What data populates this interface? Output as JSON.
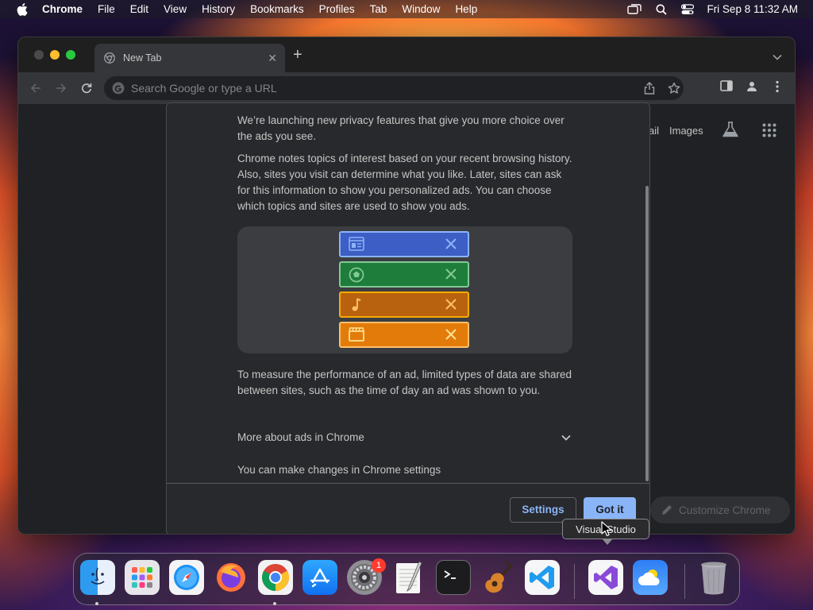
{
  "menubar": {
    "app_name": "Chrome",
    "items": [
      "File",
      "Edit",
      "View",
      "History",
      "Bookmarks",
      "Profiles",
      "Tab",
      "Window",
      "Help"
    ],
    "clock": "Fri Sep 8  11:32 AM"
  },
  "browser": {
    "tab_title": "New Tab",
    "omnibox_placeholder": "Search Google or type a URL",
    "ntp": {
      "gmail_label": "ail",
      "images_label": "Images",
      "customize_label": "Customize Chrome"
    }
  },
  "dialog": {
    "intro": "We’re launching new privacy features that give you more choice over the ads you see.",
    "topics_text": "Chrome notes topics of interest based on your recent browsing history. Also, sites you visit can determine what you like. Later, sites can ask for this information to show you personalized ads. You can choose which topics and sites are used to show you ads.",
    "measure_text": "To measure the performance of an ad, limited types of data are shared between sites, such as the time of day an ad was shown to you.",
    "more_about": "More about ads in Chrome",
    "settings_note": "You can make changes in Chrome settings",
    "settings_button": "Settings",
    "got_it_button": "Got it",
    "chips": [
      {
        "icon": "news-icon",
        "color": "#3d5ec4",
        "border": "#8ab4f8"
      },
      {
        "icon": "soccer-ball-icon",
        "color": "#1e7d3a",
        "border": "#81c995"
      },
      {
        "icon": "music-note-icon",
        "color": "#b8620f",
        "border": "#f9ab00"
      },
      {
        "icon": "clapperboard-icon",
        "color": "#e37b0a",
        "border": "#fdc069"
      }
    ]
  },
  "tooltip": {
    "text": "Visual Studio"
  },
  "dock": {
    "apps": [
      "Finder",
      "Launchpad",
      "Safari",
      "Firefox",
      "Google Chrome",
      "App Store",
      "System Settings",
      "TextEdit",
      "Terminal",
      "GarageBand",
      "Visual Studio Code",
      "Visual Studio",
      "Weather",
      "Trash"
    ],
    "settings_badge": "1"
  }
}
